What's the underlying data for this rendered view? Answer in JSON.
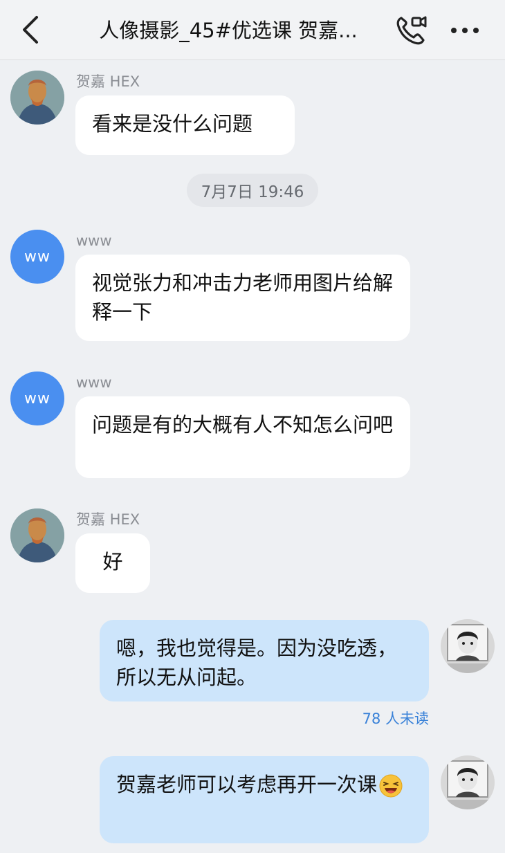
{
  "header": {
    "title": "人像摄影_45#优选课 贺嘉...",
    "back_icon": "chevron-left-icon",
    "call_icon": "phone-video-icon",
    "more_icon": "more-horizontal-icon"
  },
  "messages": [
    {
      "sender": "贺嘉 HEX",
      "text": "看来是没什么问题"
    },
    {
      "sender": "www",
      "avatar_text": "ww",
      "text": "视觉张力和冲击力老师用图片给解释一下"
    },
    {
      "sender": "www",
      "avatar_text": "ww",
      "text": "问题是有的大概有人不知怎么问吧"
    },
    {
      "sender": "贺嘉 HEX",
      "text": "好"
    },
    {
      "text": "嗯，我也觉得是。因为没吃透，所以无从问起。",
      "read_status": "78 人未读"
    },
    {
      "text": "贺嘉老师可以考虑再开一次课",
      "emoji": "laughing-face-emoji"
    }
  ],
  "timestamp": "7月7日 19:46",
  "colors": {
    "background": "#eef0f3",
    "header": "#f2f3f5",
    "incoming_bubble": "#ffffff",
    "outgoing_bubble": "#cde5fb",
    "avatar_blue": "#4a8ff0",
    "unread_text": "#3a82d8"
  }
}
